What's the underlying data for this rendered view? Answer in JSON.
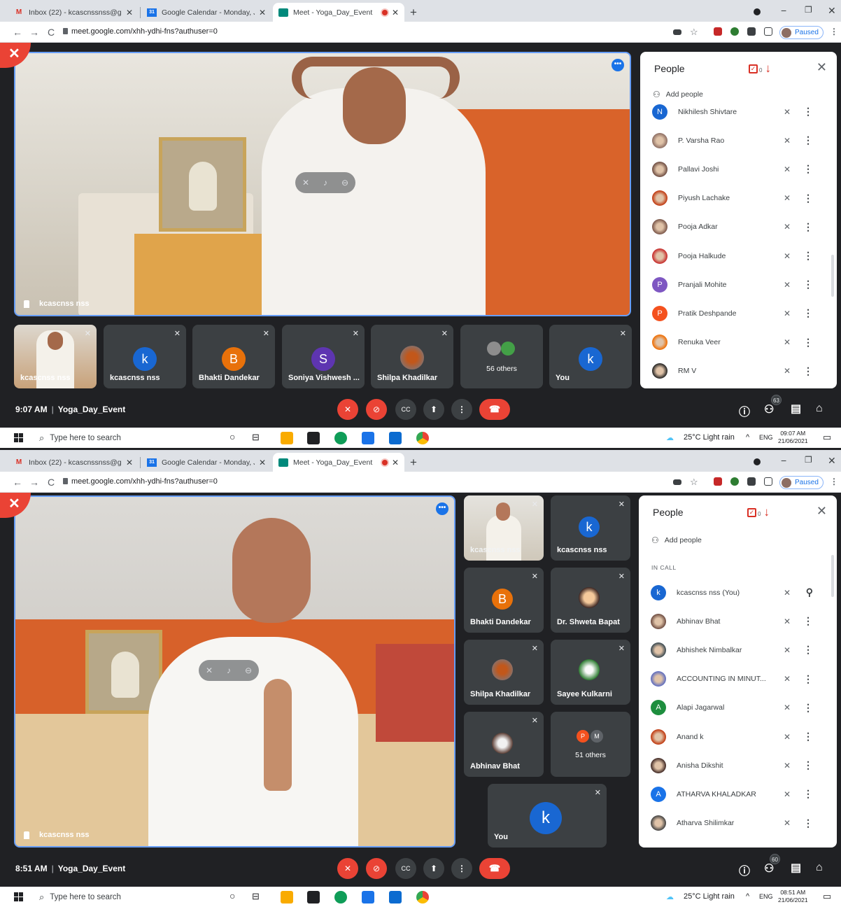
{
  "screens": [
    {
      "browser": {
        "tabs": [
          {
            "label": "Inbox (22) - kcascnssnss@gmail."
          },
          {
            "label": "Google Calendar - Monday, June"
          },
          {
            "label": "Meet - Yoga_Day_Event"
          }
        ],
        "url": "meet.google.com/xhh-ydhi-fns?authuser=0",
        "profile_status": "Paused"
      },
      "main_video": {
        "name": "kcascnss nss"
      },
      "tiles": [
        {
          "name": "kcascnss nss",
          "type": "video"
        },
        {
          "name": "kcascnss nss",
          "letter": "k",
          "color": "#1967d2"
        },
        {
          "name": "Bhakti Dandekar",
          "letter": "B",
          "color": "#e8710a"
        },
        {
          "name": "Soniya Vishwesh ...",
          "letter": "S",
          "color": "#5e35b1"
        },
        {
          "name": "Shilpa Khadilkar",
          "type": "photo"
        },
        {
          "name": "56 others",
          "type": "others"
        },
        {
          "name": "You",
          "letter": "k",
          "color": "#1967d2"
        }
      ],
      "people_panel": {
        "title": "People",
        "hand_count": "0",
        "add_people": "Add people",
        "participants": [
          {
            "name": "Nikhilesh Shivtare",
            "letter": "N",
            "color": "#1967d2"
          },
          {
            "name": "P. Varsha Rao",
            "photo": "#8d6e63"
          },
          {
            "name": "Pallavi Joshi",
            "photo": "#6d4c41"
          },
          {
            "name": "Piyush Lachake",
            "photo": "#bf360c"
          },
          {
            "name": "Pooja Adkar",
            "photo": "#795548"
          },
          {
            "name": "Pooja Halkude",
            "photo": "#c62828"
          },
          {
            "name": "Pranjali Mohite",
            "letter": "P",
            "color": "#7e57c2"
          },
          {
            "name": "Pratik Deshpande",
            "letter": "P",
            "color": "#f4511e"
          },
          {
            "name": "Renuka Veer",
            "photo": "#ef6c00"
          },
          {
            "name": "RM V",
            "photo": "#212121"
          }
        ]
      },
      "bottom_bar": {
        "time": "9:07 AM",
        "meeting_name": "Yoga_Day_Event",
        "participant_count": "63"
      },
      "taskbar": {
        "search_placeholder": "Type here to search",
        "weather": "25°C  Light rain",
        "lang": "ENG",
        "time": "09:07 AM",
        "date": "21/06/2021"
      }
    },
    {
      "browser": {
        "tabs": [
          {
            "label": "Inbox (22) - kcascnssnss@gmail."
          },
          {
            "label": "Google Calendar - Monday, June"
          },
          {
            "label": "Meet - Yoga_Day_Event"
          }
        ],
        "url": "meet.google.com/xhh-ydhi-fns?authuser=0",
        "profile_status": "Paused"
      },
      "main_video": {
        "name": "kcascnss nss"
      },
      "tiles": [
        {
          "name": "kcascnss nss",
          "type": "video"
        },
        {
          "name": "kcascnss nss",
          "letter": "k",
          "color": "#1967d2"
        },
        {
          "name": "Bhakti Dandekar",
          "letter": "B",
          "color": "#e8710a"
        },
        {
          "name": "Dr. Shweta Bapat",
          "type": "photo"
        },
        {
          "name": "Shilpa Khadilkar",
          "type": "photo"
        },
        {
          "name": "Sayee Kulkarni",
          "type": "photo"
        },
        {
          "name": "Abhinav Bhat",
          "type": "photo"
        },
        {
          "name": "51 others",
          "type": "others"
        },
        {
          "name": "You",
          "letter": "k",
          "color": "#1967d2"
        }
      ],
      "people_panel": {
        "title": "People",
        "hand_count": "0",
        "add_people": "Add people",
        "section_label": "IN CALL",
        "participants": [
          {
            "name": "kcascnss nss (You)",
            "letter": "k",
            "color": "#1967d2"
          },
          {
            "name": "Abhinav Bhat",
            "photo": "#6d4c41"
          },
          {
            "name": "Abhishek Nimbalkar",
            "photo": "#37474f"
          },
          {
            "name": "ACCOUNTING IN MINUT...",
            "photo": "#5c6bc0"
          },
          {
            "name": "Alapi Jagarwal",
            "letter": "A",
            "color": "#1e8e3e"
          },
          {
            "name": "Anand k",
            "photo": "#bf360c"
          },
          {
            "name": "Anisha Dikshit",
            "photo": "#3e2723"
          },
          {
            "name": "ATHARVA KHALADKAR",
            "letter": "A",
            "color": "#1a73e8"
          },
          {
            "name": "Atharva Shilimkar",
            "photo": "#424242"
          }
        ]
      },
      "bottom_bar": {
        "time": "8:51 AM",
        "meeting_name": "Yoga_Day_Event",
        "participant_count": "60"
      },
      "taskbar": {
        "search_placeholder": "Type here to search",
        "weather": "25°C  Light rain",
        "lang": "ENG",
        "time": "08:51 AM",
        "date": "21/06/2021"
      }
    }
  ]
}
